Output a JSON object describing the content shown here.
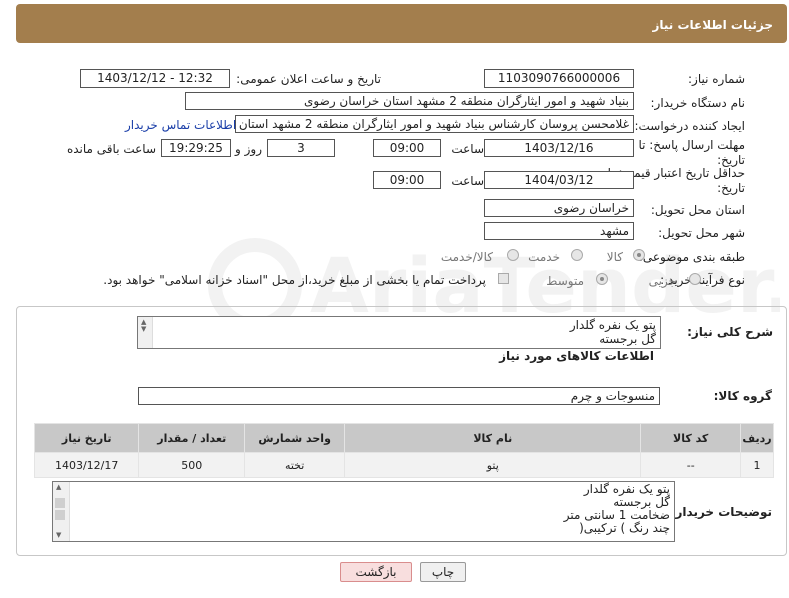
{
  "header": {
    "title": "جزئیات اطلاعات نیاز"
  },
  "form": {
    "need_number_label": "شماره نیاز:",
    "need_number": "1103090766000006",
    "announce_label": "تاریخ و ساعت اعلان عمومی:",
    "announce_value": "1403/12/12 - 12:32",
    "buyer_org_label": "نام دستگاه خریدار:",
    "buyer_org": "بنیاد شهید و امور ایثارگران منطقه 2 مشهد استان خراسان رضوی",
    "creator_label": "ایجاد کننده درخواست:",
    "creator": "غلامحسن پروسان کارشناس بنیاد شهید و امور ایثارگران منطقه 2 مشهد استان",
    "contact_link": "اطلاعات تماس خریدار",
    "deadline_label": "مهلت ارسال پاسخ: تا",
    "deadline_label2": "تاریخ:",
    "deadline_date": "1403/12/16",
    "time_label": "ساعت",
    "deadline_time": "09:00",
    "days_value": "3",
    "days_label": "روز و",
    "remaining_value": "19:29:25",
    "remaining_label": "ساعت باقی مانده",
    "validity_label": "حداقل تاریخ اعتبار قیمت: تا",
    "validity_label2": "تاریخ:",
    "validity_date": "1404/03/12",
    "validity_time": "09:00",
    "province_label": "استان محل تحویل:",
    "province": "خراسان رضوی",
    "city_label": "شهر محل تحویل:",
    "city": "مشهد",
    "category_label": "طبقه بندی موضوعی:",
    "category_options": [
      "کالا",
      "خدمت",
      "کالا/خدمت"
    ],
    "process_label": "نوع فرآیند خرید :",
    "process_options": [
      "جزیی",
      "متوسط"
    ],
    "payment_note": "پرداخت تمام یا بخشی از مبلغ خرید،از محل \"اسناد خزانه اسلامی\" خواهد بود."
  },
  "details": {
    "summary_label": "شرح کلی نیاز:",
    "summary_lines": [
      "پتو یک نفره گلدار",
      "گل برجسته"
    ],
    "goods_info_title": "اطلاعات کالاهای مورد نیاز",
    "group_label": "گروه کالا:",
    "group_value": "منسوجات و چرم",
    "table": {
      "headers": [
        "ردیف",
        "کد کالا",
        "نام کالا",
        "واحد شمارش",
        "تعداد / مقدار",
        "تاریخ نیاز"
      ],
      "rows": [
        [
          "1",
          "--",
          "پتو",
          "تخته",
          "500",
          "1403/12/17"
        ]
      ]
    },
    "buyer_notes_label": "توضیحات خریدار:",
    "buyer_notes_lines": [
      "پتو یک نفره گلدار",
      "گل برجسته",
      "ضخامت 1 سانتی متر",
      "چند رنگ ) ترکیبی("
    ]
  },
  "buttons": {
    "print": "چاپ",
    "back": "بازگشت"
  },
  "watermark": {
    "text": "AriaTender.neT"
  }
}
